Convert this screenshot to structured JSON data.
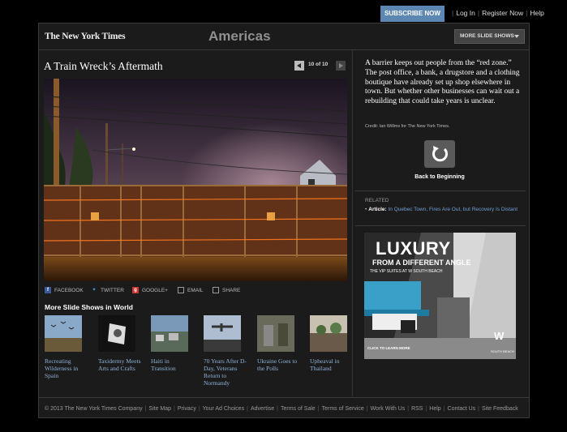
{
  "topbar": {
    "subscribe_label": "SUBSCRIBE NOW",
    "login_label": "Log In",
    "register_label": "Register Now",
    "help_label": "Help"
  },
  "header": {
    "logo_text": "The New York Times",
    "section_title": "Americas",
    "more_slideshows_label": "MORE SLIDE SHOWS"
  },
  "slideshow": {
    "title": "A Train Wreck’s Aftermath",
    "pager": "10 of 10",
    "caption": "A barrier keeps out people from the “red zone.” The post office, a bank, a drugstore and a clothing boutique have already set up shop elsewhere in town. But whether other businesses can wait out a rebuilding that could take years is unclear.",
    "credit": "Credit: Ian Willms for The New York Times.",
    "back_label": "Back to Beginning"
  },
  "share": {
    "facebook": "FACEBOOK",
    "twitter": "TWITTER",
    "google": "GOOGLE+",
    "email": "EMAIL",
    "share": "SHARE"
  },
  "more_shows": {
    "title": "More Slide Shows in World",
    "items": [
      {
        "caption": "Recreating Wilderness in Spain"
      },
      {
        "caption": "Taxidermy Meets Arts and Crafts"
      },
      {
        "caption": "Haiti in Transition"
      },
      {
        "caption": "70 Years After D-Day, Veterans Return to Normandy"
      },
      {
        "caption": "Ukraine Goes to the Polls"
      },
      {
        "caption": "Upheaval in Thailand"
      }
    ]
  },
  "related": {
    "label": "RELATED",
    "kind": "Article:",
    "link": "In Quebec Town, Fires Are Out, but Recovery Is Distant"
  },
  "ad": {
    "headline": "LUXURY",
    "tagline": "FROM A DIFFERENT ANGLE",
    "sub": "THE VIP SUITES AT W SOUTH BEACH",
    "cta": "CLICK TO LEARN MORE",
    "logo": "W",
    "brand": "SOUTH BEACH"
  },
  "footer": {
    "links": [
      "© 2013 The New York Times Company",
      "Site Map",
      "Privacy",
      "Your Ad Choices",
      "Advertise",
      "Terms of Sale",
      "Terms of Service",
      "Work With Us",
      "RSS",
      "Help",
      "Contact Us",
      "Site Feedback"
    ]
  },
  "colors": {
    "subscribe": "#5c87b2",
    "link": "#8fb3d9",
    "background": "#1b1b1b"
  }
}
